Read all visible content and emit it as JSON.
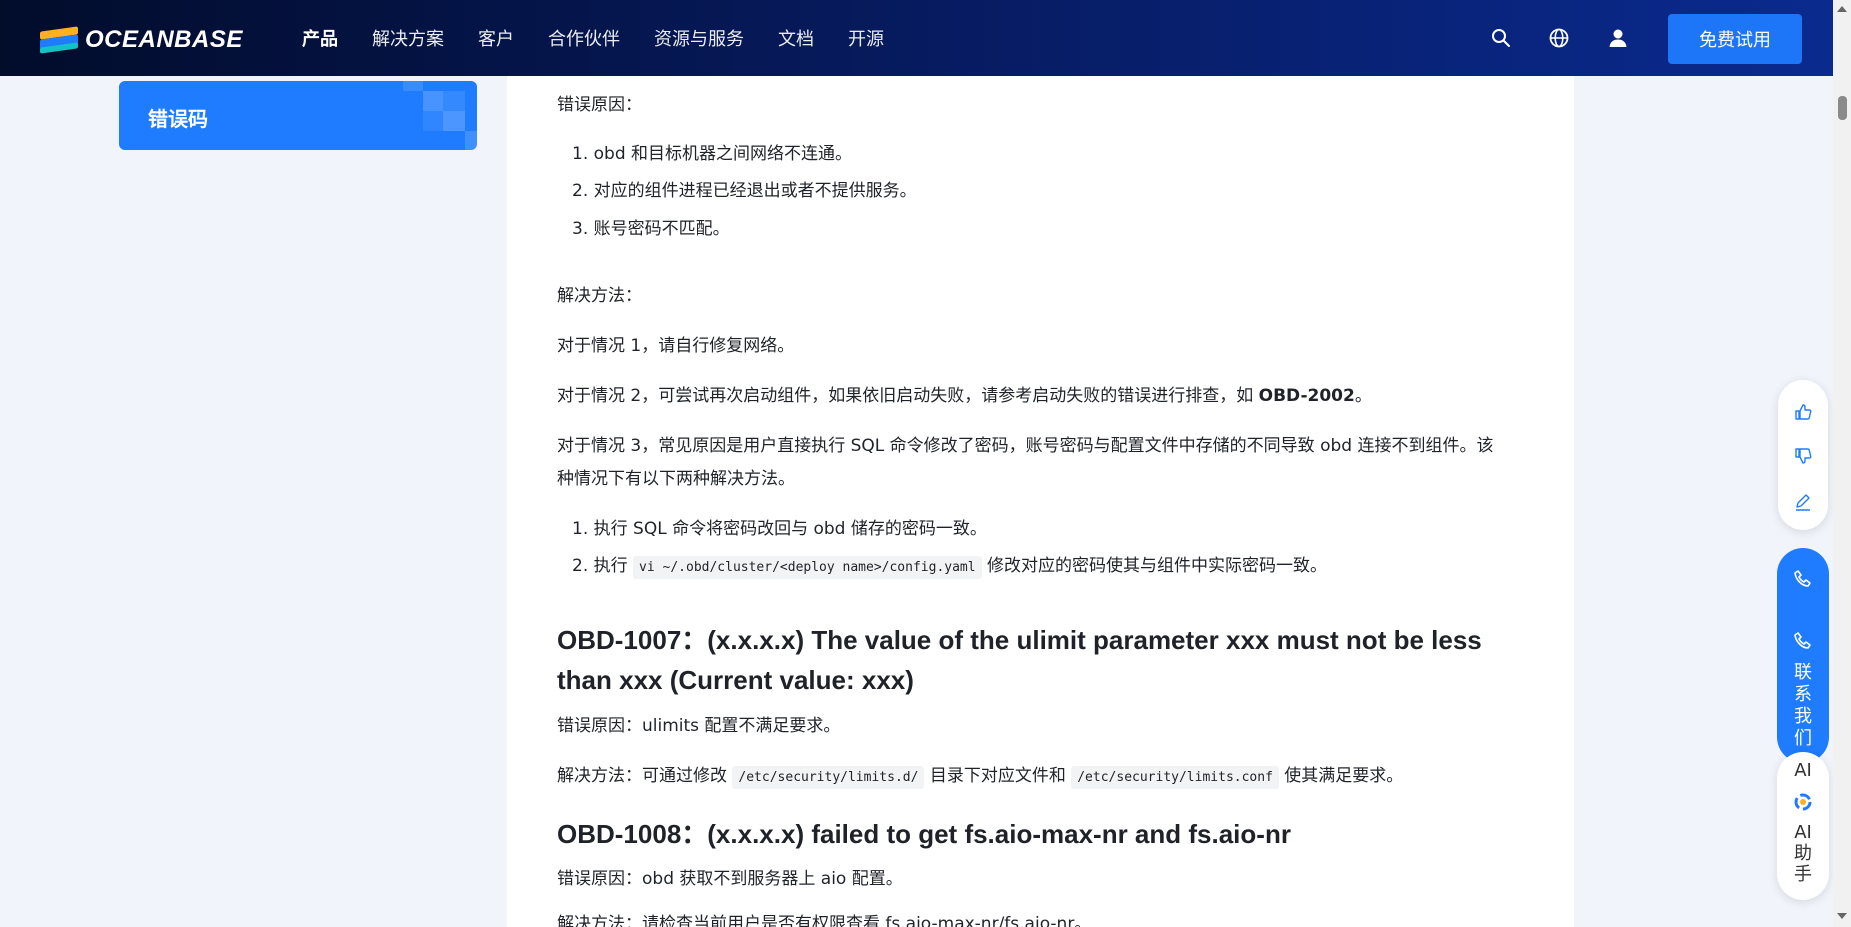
{
  "header": {
    "logo_text": "OCEANBASE",
    "nav": [
      "产品",
      "解决方案",
      "客户",
      "合作伙伴",
      "资源与服务",
      "文档",
      "开源"
    ],
    "active_index": 0,
    "trial_button": "免费试用"
  },
  "sidebar": {
    "active_item": "错误码"
  },
  "content": {
    "cause_label": "错误原因：",
    "causes": [
      "1. obd 和目标机器之间网络不连通。",
      "2. 对应的组件进程已经退出或者不提供服务。",
      "3. 账号密码不匹配。"
    ],
    "solution_label": "解决方法：",
    "case1": "对于情况 1，请自行修复网络。",
    "case2_prefix": "对于情况 2，可尝试再次启动组件，如果依旧启动失败，请参考启动失败的错误进行排查，如 ",
    "case2_bold": "OBD-2002",
    "case2_suffix": "。",
    "case3_line1": "对于情况 3，常见原因是用户直接执行 SQL 命令修改了密码，账号密码与配置文件中存储的不同导致 obd 连接不到组件。该",
    "case3_line2": "种情况下有以下两种解决方法。",
    "fix1": "1. 执行 SQL 命令将密码改回与 obd 储存的密码一致。",
    "fix2_prefix": "2. 执行 ",
    "fix2_code": "vi ~/.obd/cluster/<deploy name>/config.yaml",
    "fix2_suffix": " 修改对应的密码使其与组件中实际密码一致。",
    "h1007_line1": "OBD-1007：(x.x.x.x) The value of the ulimit parameter xxx must not be less",
    "h1007_line2": "than xxx (Current value: xxx)",
    "e1007_cause": "错误原因：ulimits 配置不满足要求。",
    "e1007_sol_prefix": "解决方法：可通过修改 ",
    "e1007_code1": "/etc/security/limits.d/",
    "e1007_sol_mid": " 目录下对应文件和 ",
    "e1007_code2": "/etc/security/limits.conf",
    "e1007_sol_suffix": " 使其满足要求。",
    "h1008": "OBD-1008：(x.x.x.x) failed to get fs.aio-max-nr and fs.aio-nr",
    "e1008_cause": "错误原因：obd 获取不到服务器上 aio 配置。",
    "e1008_sol_partial": "解决方法：请检查当前用户是否有权限查看 fs.aio-max-nr/fs.aio-nr。"
  },
  "floating": {
    "contact_chars": [
      "联",
      "系",
      "我",
      "们"
    ],
    "ai_top": "AI",
    "ai_chars": [
      "AI",
      "助",
      "手"
    ]
  },
  "colors": {
    "accent": "#1f7cff",
    "header_dark": "#020c2b"
  }
}
